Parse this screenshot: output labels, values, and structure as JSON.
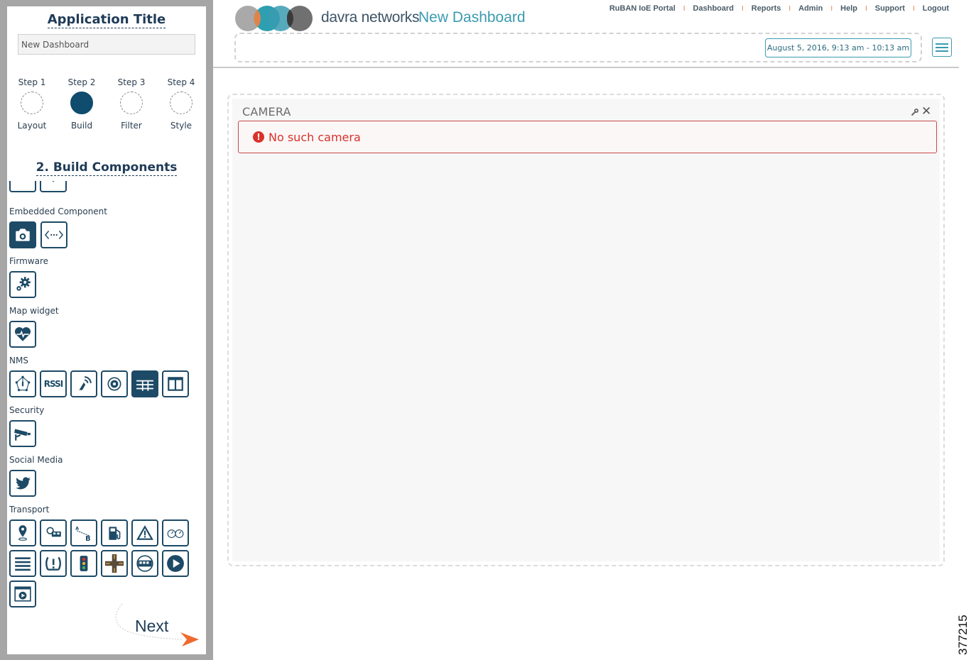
{
  "sidebar": {
    "app_title": "Application Title",
    "title_input_value": "New Dashboard",
    "steps": [
      {
        "number": "Step 1",
        "name": "Layout"
      },
      {
        "number": "Step 2",
        "name": "Build"
      },
      {
        "number": "Step 3",
        "name": "Filter"
      },
      {
        "number": "Step 4",
        "name": "Style"
      }
    ],
    "active_step": "Build",
    "section_title": "2. Build Components",
    "categories": {
      "embedded": "Embedded Component",
      "firmware": "Firmware",
      "map": "Map widget",
      "nms": "NMS",
      "security": "Security",
      "social": "Social Media",
      "transport": "Transport"
    },
    "icons": {
      "embedded": [
        "camera-icon",
        "embed-code-icon"
      ],
      "firmware": [
        "gears-icon"
      ],
      "map": [
        "heart-pulse-icon"
      ],
      "nms": [
        "network-topology-icon",
        "rssi-icon",
        "wireless-signal-icon",
        "access-point-icon",
        "grid-table-icon",
        "split-panel-icon"
      ],
      "security": [
        "security-camera-icon"
      ],
      "social": [
        "twitter-icon"
      ],
      "transport": [
        "map-pin-icon",
        "bus-driver-icon",
        "route-a-to-b-icon",
        "fuel-pump-icon",
        "warning-triangle-icon",
        "speedometer-icon",
        "list-icon",
        "tire-pressure-icon",
        "traffic-light-icon",
        "intersection-icon",
        "bus-icon",
        "play-circle-icon",
        "video-player-icon"
      ]
    },
    "rssi_label": "RSSI",
    "next_label": "Next"
  },
  "header": {
    "brand": "davra networks",
    "dashboard_name": "New Dashboard",
    "nav": [
      "RuBAN IoE Portal",
      "Dashboard",
      "Reports",
      "Admin",
      "Help",
      "Support",
      "Logout"
    ],
    "nav_separator": "I",
    "date_range": "August 5, 2016, 9:13 am - 10:13 am"
  },
  "widget": {
    "title": "CAMERA",
    "close_symbol": "✕",
    "error_symbol": "!",
    "error_message": "No such camera"
  },
  "figure_id": "377215",
  "colors": {
    "accent_dark": "#1d4a66",
    "accent_teal": "#3a9bb0",
    "error": "#d9322b",
    "nav_separator": "#e0834a",
    "sidebar_frame": "#a6a6a6"
  }
}
